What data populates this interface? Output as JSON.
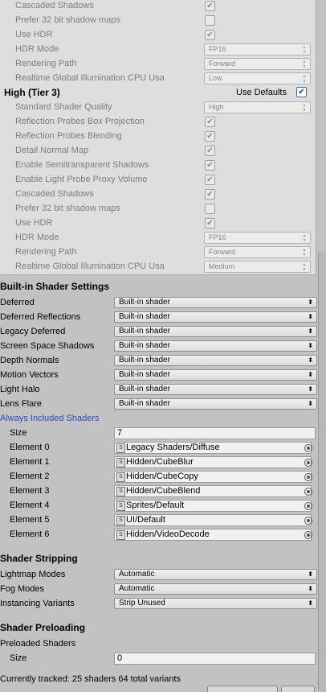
{
  "tier_top": {
    "rows": [
      {
        "label": "Cascaded Shadows",
        "type": "check",
        "checked": true
      },
      {
        "label": "Prefer 32 bit shadow maps",
        "type": "check",
        "checked": false
      },
      {
        "label": "Use HDR",
        "type": "check",
        "checked": true
      },
      {
        "label": "HDR Mode",
        "type": "dropdown",
        "value": "FP16"
      },
      {
        "label": "Rendering Path",
        "type": "dropdown",
        "value": "Forward"
      },
      {
        "label": "Realtime Global Illumination CPU Usa",
        "type": "dropdown",
        "value": "Low"
      }
    ]
  },
  "tier3": {
    "title": "High (Tier 3)",
    "use_defaults_label": "Use Defaults",
    "use_defaults_checked": true,
    "rows": [
      {
        "label": "Standard Shader Quality",
        "type": "dropdown",
        "value": "High"
      },
      {
        "label": "Reflection Probes Box Projection",
        "type": "check",
        "checked": true
      },
      {
        "label": "Reflection Probes Blending",
        "type": "check",
        "checked": true
      },
      {
        "label": "Detail Normal Map",
        "type": "check",
        "checked": true
      },
      {
        "label": "Enable Semitransparent Shadows",
        "type": "check",
        "checked": true
      },
      {
        "label": "Enable Light Probe Proxy Volume",
        "type": "check",
        "checked": true
      },
      {
        "label": "Cascaded Shadows",
        "type": "check",
        "checked": true
      },
      {
        "label": "Prefer 32 bit shadow maps",
        "type": "check",
        "checked": false
      },
      {
        "label": "Use HDR",
        "type": "check",
        "checked": true
      },
      {
        "label": "HDR Mode",
        "type": "dropdown",
        "value": "FP16"
      },
      {
        "label": "Rendering Path",
        "type": "dropdown",
        "value": "Forward"
      },
      {
        "label": "Realtime Global Illumination CPU Usa",
        "type": "dropdown",
        "value": "Medium"
      }
    ]
  },
  "builtin": {
    "title": "Built-in Shader Settings",
    "rows": [
      {
        "label": "Deferred",
        "value": "Built-in shader"
      },
      {
        "label": "Deferred Reflections",
        "value": "Built-in shader"
      },
      {
        "label": "Legacy Deferred",
        "value": "Built-in shader"
      },
      {
        "label": "Screen Space Shadows",
        "value": "Built-in shader"
      },
      {
        "label": "Depth Normals",
        "value": "Built-in shader"
      },
      {
        "label": "Motion Vectors",
        "value": "Built-in shader"
      },
      {
        "label": "Light Halo",
        "value": "Built-in shader"
      },
      {
        "label": "Lens Flare",
        "value": "Built-in shader"
      }
    ]
  },
  "always_included": {
    "title": "Always Included Shaders",
    "size_label": "Size",
    "size_value": "7",
    "elements": [
      {
        "label": "Element 0",
        "value": "Legacy Shaders/Diffuse"
      },
      {
        "label": "Element 1",
        "value": "Hidden/CubeBlur"
      },
      {
        "label": "Element 2",
        "value": "Hidden/CubeCopy"
      },
      {
        "label": "Element 3",
        "value": "Hidden/CubeBlend"
      },
      {
        "label": "Element 4",
        "value": "Sprites/Default"
      },
      {
        "label": "Element 5",
        "value": "UI/Default"
      },
      {
        "label": "Element 6",
        "value": "Hidden/VideoDecode"
      }
    ]
  },
  "stripping": {
    "title": "Shader Stripping",
    "rows": [
      {
        "label": "Lightmap Modes",
        "value": "Automatic"
      },
      {
        "label": "Fog Modes",
        "value": "Automatic"
      },
      {
        "label": "Instancing Variants",
        "value": "Strip Unused"
      }
    ]
  },
  "preloading": {
    "title": "Shader Preloading",
    "preloaded_label": "Preloaded Shaders",
    "size_label": "Size",
    "size_value": "0"
  },
  "footer": {
    "tracked_text": "Currently tracked: 25 shaders 64 total variants"
  },
  "icons": {
    "check": "checkmark-icon",
    "dropdown_arrow": "updown-arrow-icon",
    "shader": "shader-asset-icon",
    "picker": "object-picker-icon"
  }
}
